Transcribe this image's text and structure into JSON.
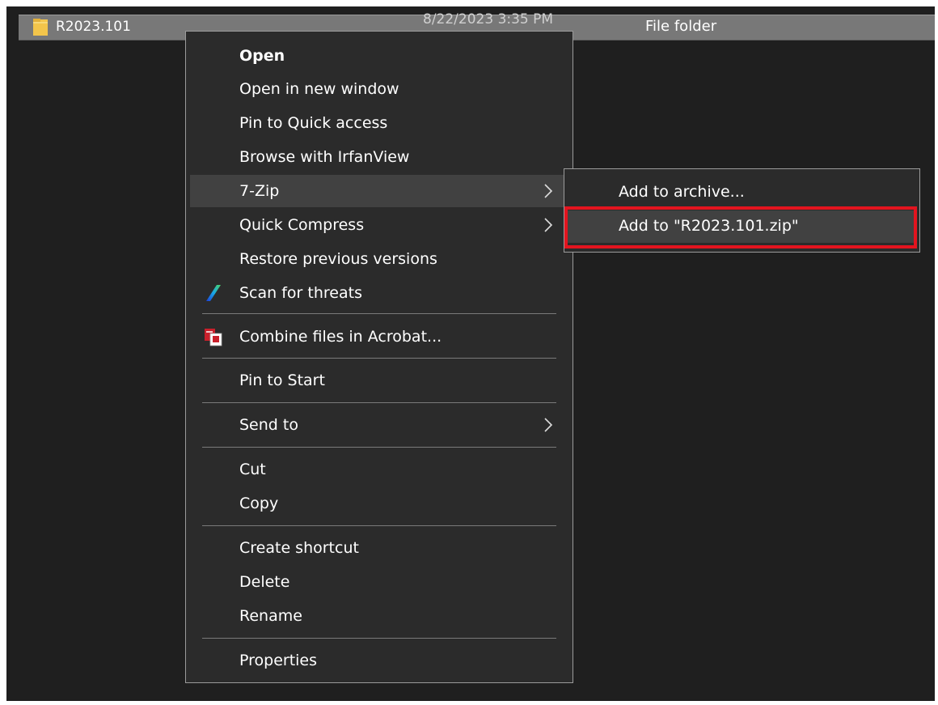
{
  "file": {
    "name": "R2023.101",
    "date": "8/22/2023 3:35 PM",
    "type": "File folder"
  },
  "icons": {
    "folder": "folder-icon",
    "scan": "scan-threats-icon",
    "acrobat": "acrobat-combine-icon",
    "submenu_arrow": "chevron-right-icon"
  },
  "colors": {
    "menu_bg": "#2b2b2b",
    "hover_bg": "#414141",
    "highlight_border": "#e3141f",
    "selected_row": "#787878"
  },
  "menu": {
    "open": "Open",
    "open_new_window": "Open in new window",
    "pin_quick_access": "Pin to Quick access",
    "browse_irfanview": "Browse with IrfanView",
    "seven_zip": "7-Zip",
    "quick_compress": "Quick Compress",
    "restore_versions": "Restore previous versions",
    "scan_threats": "Scan for threats",
    "combine_acrobat": "Combine files in Acrobat...",
    "pin_start": "Pin to Start",
    "send_to": "Send to",
    "cut": "Cut",
    "copy": "Copy",
    "create_shortcut": "Create shortcut",
    "delete": "Delete",
    "rename": "Rename",
    "properties": "Properties"
  },
  "submenu": {
    "add_archive": "Add to archive...",
    "add_zip": "Add to \"R2023.101.zip\""
  }
}
